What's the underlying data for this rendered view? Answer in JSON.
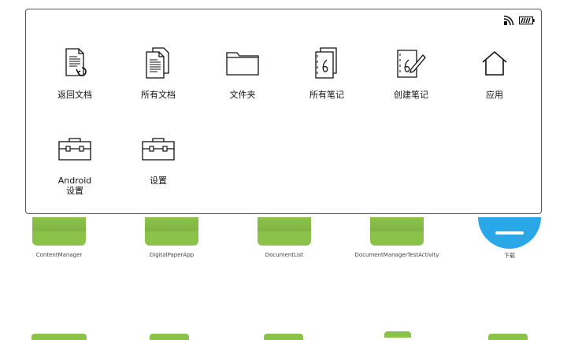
{
  "status_bar": {
    "icons": [
      "wireless-icon",
      "battery-icon"
    ]
  },
  "menu": {
    "items": [
      {
        "label": "返回文档",
        "icon": "return-document-icon"
      },
      {
        "label": "所有文档",
        "icon": "all-documents-icon"
      },
      {
        "label": "文件夹",
        "icon": "folder-icon"
      },
      {
        "label": "所有笔记",
        "icon": "all-notes-icon"
      },
      {
        "label": "创建笔记",
        "icon": "create-note-icon"
      },
      {
        "label": "应用",
        "icon": "home-icon"
      },
      {
        "label": "Android\n设置",
        "icon": "toolbox-icon"
      },
      {
        "label": "设置",
        "icon": "toolbox-icon"
      }
    ]
  },
  "background_apps": [
    {
      "label": "ContentManager"
    },
    {
      "label": "DigitalPaperApp"
    },
    {
      "label": "DocumentList"
    },
    {
      "label": "DocumentManagerTestActivity"
    },
    {
      "label": "下载"
    }
  ],
  "colors": {
    "app_icon_green": "#8bc34a",
    "download_blue": "#2aa7e6",
    "panel_border": "#555555"
  }
}
